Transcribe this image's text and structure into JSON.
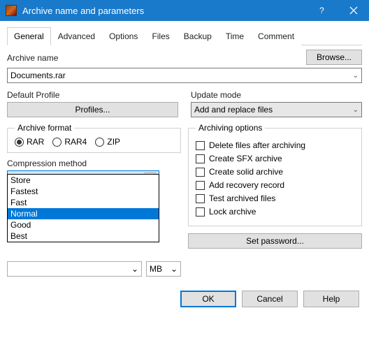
{
  "title": "Archive name and parameters",
  "tabs": [
    "General",
    "Advanced",
    "Options",
    "Files",
    "Backup",
    "Time",
    "Comment"
  ],
  "archive_name_label": "Archive name",
  "browse_label": "Browse...",
  "archive_name_value": "Documents.rar",
  "default_profile_label": "Default Profile",
  "profiles_btn": "Profiles...",
  "update_mode_label": "Update mode",
  "update_mode_value": "Add and replace files",
  "archive_format": {
    "legend": "Archive format",
    "options": [
      "RAR",
      "RAR4",
      "ZIP"
    ],
    "selected": "RAR"
  },
  "archiving_options": {
    "legend": "Archiving options",
    "items": [
      "Delete files after archiving",
      "Create SFX archive",
      "Create solid archive",
      "Add recovery record",
      "Test archived files",
      "Lock archive"
    ]
  },
  "compression_method_label": "Compression method",
  "compression_method_value": "Normal",
  "compression_options": [
    "Store",
    "Fastest",
    "Fast",
    "Normal",
    "Good",
    "Best"
  ],
  "size_unit": "MB",
  "set_password_label": "Set password...",
  "footer": {
    "ok": "OK",
    "cancel": "Cancel",
    "help": "Help"
  }
}
